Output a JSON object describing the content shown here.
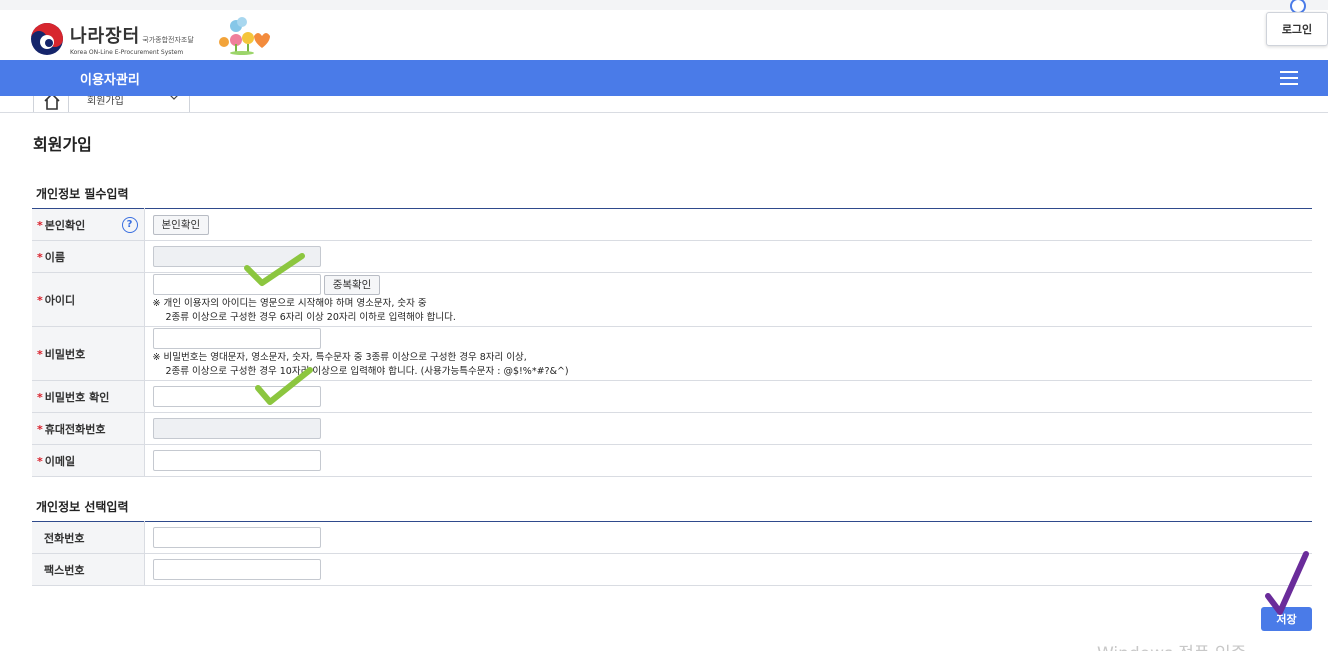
{
  "header": {
    "logo_main": "나라장터",
    "logo_small": "국가종합전자조달",
    "logo_sub": "Korea ON-Line E-Procurement System",
    "login_label": "로그인"
  },
  "nav": {
    "title": "이용자관리",
    "breadcrumb": "회원가입"
  },
  "page": {
    "title": "회원가입"
  },
  "required_section": {
    "title": "개인정보 필수입력",
    "rows": {
      "identity": {
        "label": "본인확인",
        "button": "본인확인"
      },
      "name": {
        "label": "이름"
      },
      "user_id": {
        "label": "아이디",
        "button": "중복확인",
        "note_line1": "※ 개인 이용자의 아이디는 영문으로 시작해야 하며 영소문자, 숫자 중",
        "note_line2": "2종류 이상으로 구성한 경우 6자리 이상 20자리 이하로 입력해야 합니다."
      },
      "password": {
        "label": "비밀번호",
        "note_line1": "※ 비밀번호는 영대문자, 영소문자, 숫자, 특수문자 중 3종류 이상으로 구성한 경우 8자리 이상,",
        "note_line2": "2종류 이상으로 구성한 경우 10자리 이상으로 입력해야 합니다. (사용가능특수문자 : @$!%*#?&^)"
      },
      "password_confirm": {
        "label": "비밀번호 확인"
      },
      "mobile": {
        "label": "휴대전화번호"
      },
      "email": {
        "label": "이메일"
      }
    }
  },
  "optional_section": {
    "title": "개인정보 선택입력",
    "rows": {
      "phone": {
        "label": "전화번호"
      },
      "fax": {
        "label": "팩스번호"
      }
    }
  },
  "actions": {
    "save_label": "저장"
  },
  "watermark": "Windows 정품 인증",
  "colors": {
    "primary": "#4a7be8",
    "required_mark": "#d91f2a",
    "check_green": "#8cc63f",
    "check_purple": "#6a2c9a"
  }
}
